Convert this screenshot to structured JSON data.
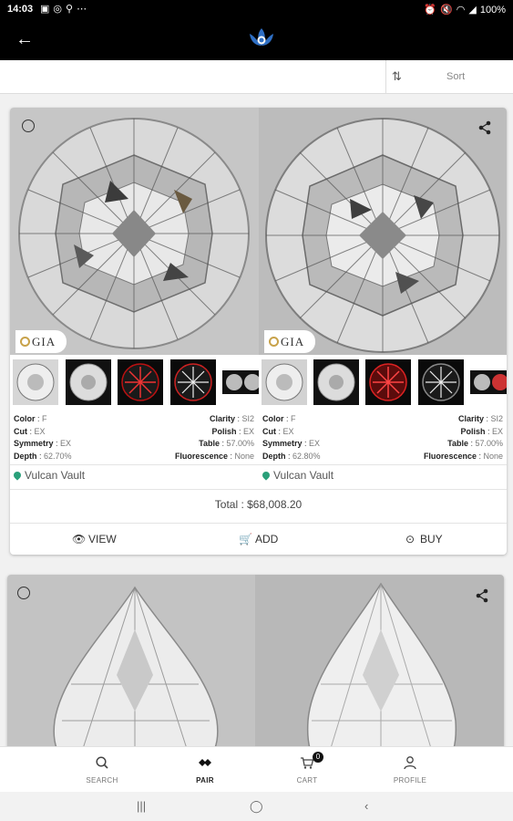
{
  "status_bar": {
    "time": "14:03",
    "notification_icons": [
      "image-icon",
      "whatsapp-icon",
      "location-icon",
      "more-icon"
    ],
    "right_icons": [
      "alarm-icon",
      "mute-icon",
      "wifi-icon",
      "signal-icon"
    ],
    "battery": "100%"
  },
  "app_bar": {
    "logo": "brand-lotus-logo"
  },
  "sort": {
    "label": "Sort"
  },
  "cards": [
    {
      "left": {
        "lab": "GIA",
        "specs": {
          "color_label": "Color",
          "color": "F",
          "cut_label": "Cut",
          "cut": "EX",
          "symmetry_label": "Symmetry",
          "symmetry": "EX",
          "depth_label": "Depth",
          "depth": "62.70%",
          "clarity_label": "Clarity",
          "clarity": "SI2",
          "polish_label": "Polish",
          "polish": "EX",
          "table_label": "Table",
          "table": "57.00%",
          "fluorescence_label": "Fluorescence",
          "fluorescence": "None"
        },
        "vendor": "Vulcan Vault"
      },
      "right": {
        "lab": "GIA",
        "specs": {
          "color_label": "Color",
          "color": "F",
          "cut_label": "Cut",
          "cut": "EX",
          "symmetry_label": "Symmetry",
          "symmetry": "EX",
          "depth_label": "Depth",
          "depth": "62.80%",
          "clarity_label": "Clarity",
          "clarity": "SI2",
          "polish_label": "Polish",
          "polish": "EX",
          "table_label": "Table",
          "table": "57.00%",
          "fluorescence_label": "Fluorescence",
          "fluorescence": "None"
        },
        "vendor": "Vulcan Vault"
      },
      "total": "Total : $68,008.20",
      "actions": {
        "view": "VIEW",
        "add": "ADD",
        "buy": "BUY"
      }
    }
  ],
  "bottom_nav": {
    "search": "SEARCH",
    "pair": "PAIR",
    "cart": "CART",
    "cart_count": "0",
    "profile": "PROFILE"
  },
  "colors": {
    "app_bar": "#000000",
    "accent_pin": "#2aa07a",
    "gia_seal": "#c8a24a",
    "logo_blue": "#2f6fc4"
  }
}
